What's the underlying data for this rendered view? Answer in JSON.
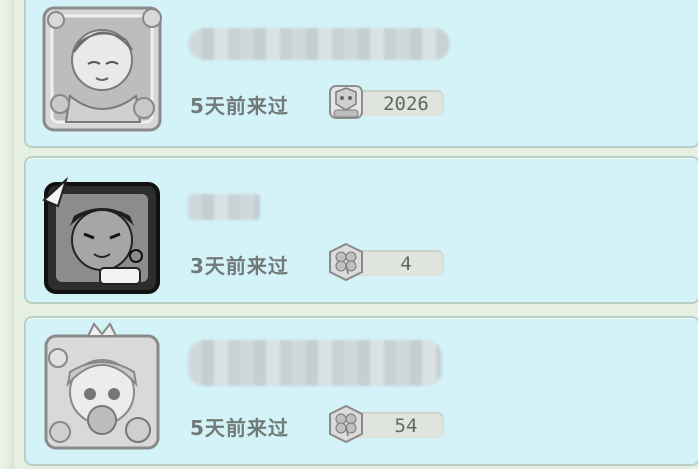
{
  "friends": [
    {
      "last_visit": "5天前来过",
      "score": "2026",
      "badge_icon": "mimi-badge-icon",
      "avatar_icon": "anime-character-avatar"
    },
    {
      "last_visit": "3天前来过",
      "score": "4",
      "badge_icon": "clover-badge-icon",
      "avatar_icon": "cartoon-cat-girl-avatar"
    },
    {
      "last_visit": "5天前来过",
      "score": "54",
      "badge_icon": "clover-badge-icon",
      "avatar_icon": "princess-girl-avatar"
    }
  ],
  "colors": {
    "row_background": "#d3f3f8",
    "row_border": "#b9cfc5",
    "text_gray": "#707a77",
    "pill_background": "#dfe5dd"
  }
}
